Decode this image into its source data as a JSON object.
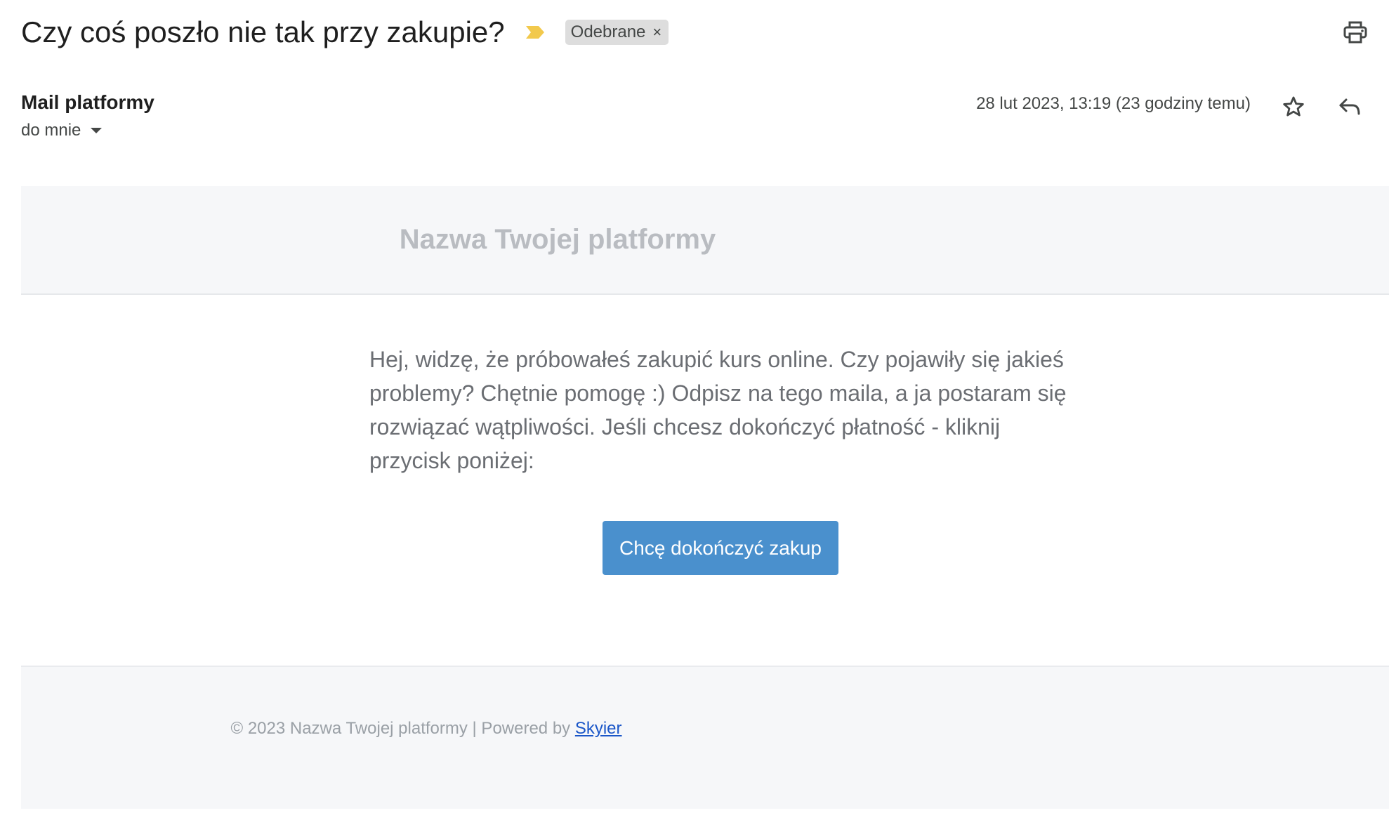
{
  "header": {
    "subject": "Czy coś poszło nie tak przy zakupie?",
    "label_chip": "Odebrane",
    "label_chip_close": "×",
    "importance_color": "#f2c94c"
  },
  "message_meta": {
    "sender_name": "Mail platformy",
    "recipient": "do mnie",
    "date": "28 lut 2023, 13:19 (23 godziny temu)"
  },
  "email": {
    "brand_name": "Nazwa Twojej platformy",
    "body": "Hej, widzę, że próbowałeś zakupić kurs online. Czy pojawiły się jakieś problemy? Chętnie pomogę :) Odpisz na tego maila, a ja postaram się rozwiązać wątpliwości. Jeśli chcesz dokończyć płatność - kliknij przycisk poniżej:",
    "cta_label": "Chcę dokończyć zakup",
    "footer_text": "© 2023 Nazwa Twojej platformy | Powered by ",
    "footer_link": "Skyier"
  },
  "icons": {
    "print": "print-icon",
    "star": "star-icon",
    "reply": "reply-icon",
    "importance": "importance-marker-icon",
    "caret": "chevron-down-icon"
  },
  "colors": {
    "cta_background": "#4a90cd",
    "band_background": "#f6f7f9",
    "link": "#1a56c8"
  }
}
